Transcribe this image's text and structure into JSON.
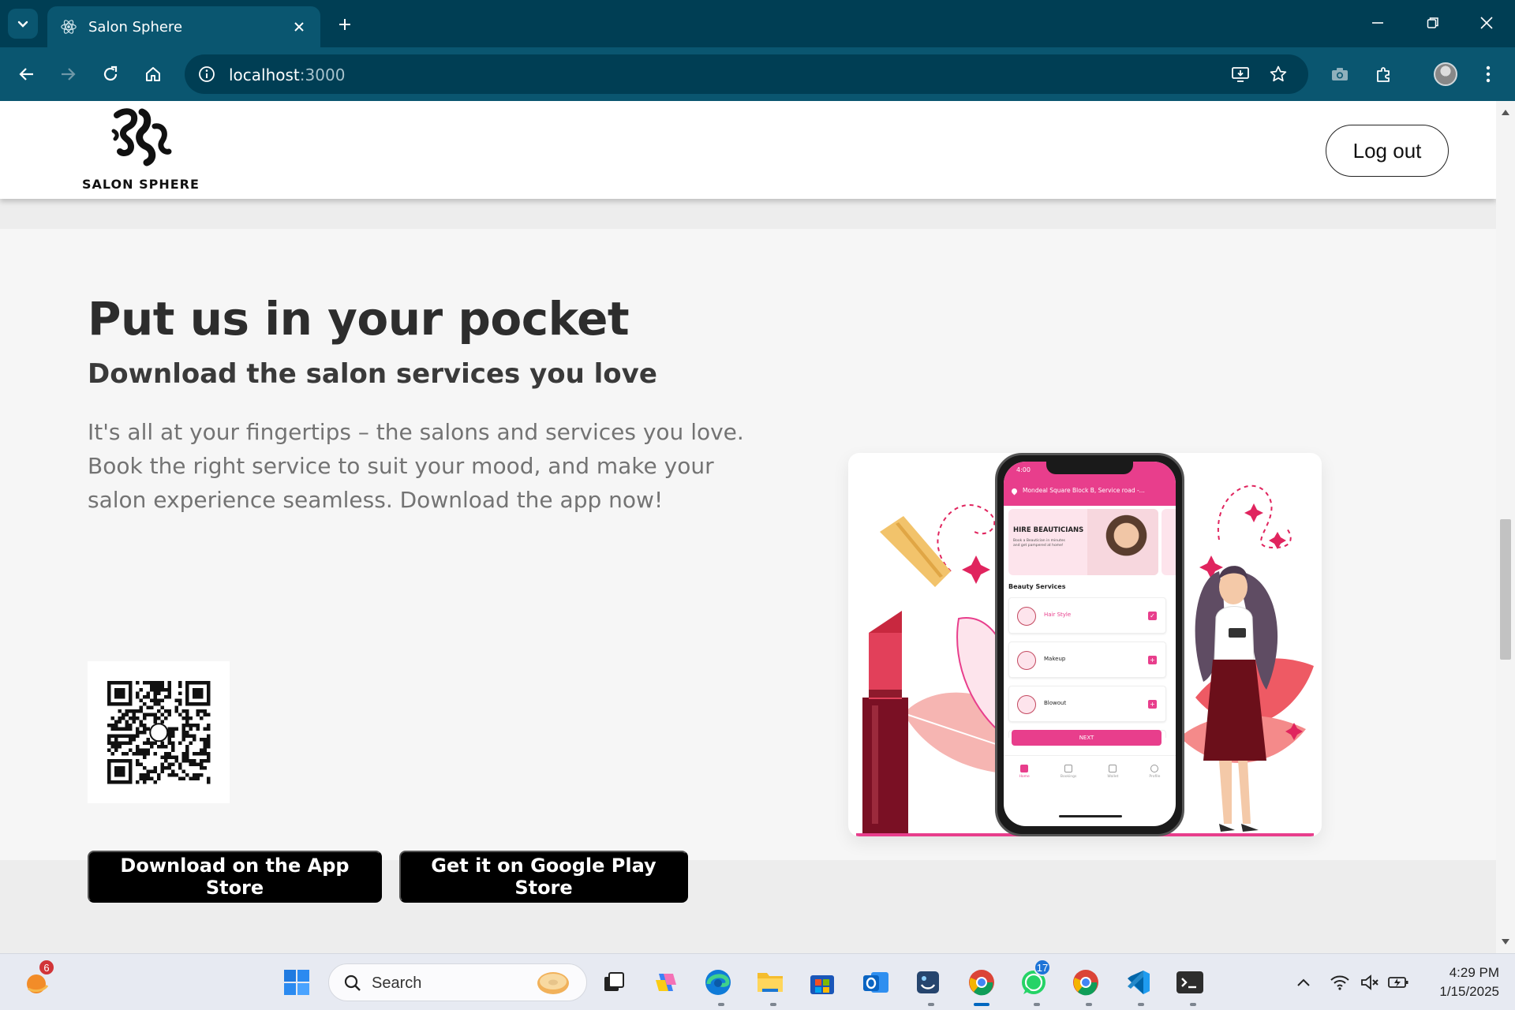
{
  "browser": {
    "tab_title": "Salon Sphere",
    "url_host": "localhost",
    "url_port": ":3000"
  },
  "site": {
    "logo_text": "SALON SPHERE",
    "logout_label": "Log out"
  },
  "hero": {
    "title": "Put us in your pocket",
    "subtitle": "Download the salon services you love",
    "body": "It's all at your fingertips – the salons and services you love. Book the right service to suit your mood, and make your salon experience seamless. Download the app now!",
    "app_store_label": "Download on the App Store",
    "play_store_label": "Get it on Google Play Store"
  },
  "phone_app": {
    "time": "4:00",
    "location": "Mondeal Square Block B, Service road -...",
    "banner_title": "HIRE BEAUTICIANS",
    "banner_text": "Book a Beautician in minutes and get pampered at home!",
    "section_title": "Beauty Services",
    "services": [
      {
        "name": "Hair Style",
        "selected": true
      },
      {
        "name": "Makeup",
        "selected": false
      },
      {
        "name": "Blowout",
        "selected": false
      }
    ],
    "next_label": "NEXT",
    "nav": [
      "Home",
      "Bookings",
      "Wallet",
      "Profile"
    ]
  },
  "taskbar": {
    "search_placeholder": "Search",
    "time": "4:29 PM",
    "date": "1/15/2025",
    "weather_badge": "6",
    "whatsapp_badge": "17"
  },
  "colors": {
    "chrome_dark": "#003e54",
    "chrome_toolbar": "#0a5670",
    "brand_pink": "#e83e8c",
    "button_black": "#000000"
  }
}
